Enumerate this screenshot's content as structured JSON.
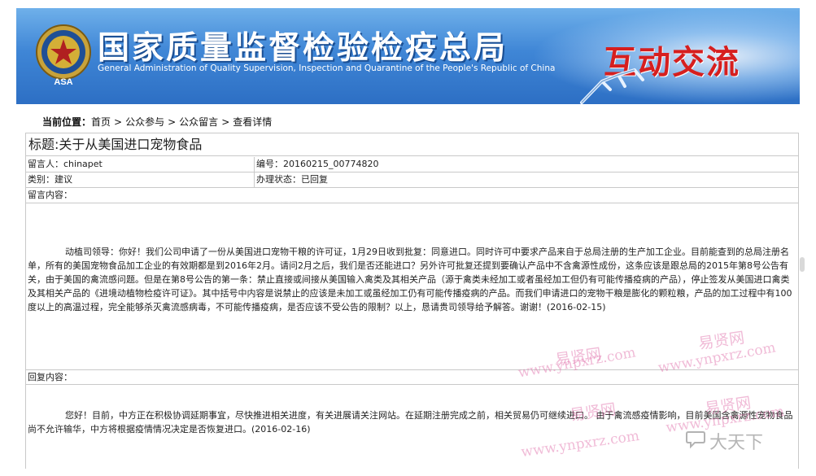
{
  "header": {
    "title": "国家质量监督检验检疫总局",
    "subtitle": "General Administration of Quality Supervision, Inspection and Quarantine of the People's Republic of China",
    "section_tag": "互动交流",
    "emblem_text": "ASA"
  },
  "breadcrumb": {
    "label": "当前位置：",
    "items": [
      "首页",
      "公众参与",
      "公众留言",
      "查看详情"
    ],
    "separator": ">"
  },
  "message": {
    "title": "标题:关于从美国进口宠物食品",
    "author_label": "留言人：",
    "author": "chinapet",
    "id_label": "编号：",
    "id": "20160215_00774820",
    "category_label": "类别：",
    "category": "建议",
    "status_label": "办理状态：",
    "status": "已回复",
    "content_label": "留言内容：",
    "content": "动植司领导：你好！我们公司申请了一份从美国进口宠物干粮的许可证，1月29日收到批复：同意进口。同时许可中要求产品来自于总局注册的生产加工企业。目前能查到的总局注册名单，所有的美国宠物食品加工企业的有效期都是到2016年2月。请问2月之后，我们是否还能进口？另外许可批复还提到要确认产品中不含禽源性成份，这条应该是跟总局的2015年第8号公告有关，由于美国的禽流感问题。但是在第8号公告的第一条：禁止直接或间接从美国输入禽类及其相关产品（源于禽类未经加工或者虽经加工但仍有可能传播疫病的产品），停止签发从美国进口禽类及其相关产品的《进境动植物检疫许可证》。其中括号中内容是说禁止的应该是未加工或虽经加工仍有可能传播疫病的产品。而我们申请进口的宠物干粮是膨化的颗粒粮，产品的加工过程中有100度以上的高温过程，完全能够杀灭禽流感病毒，不可能传播疫病，是否应该不受公告的限制？以上，恳请贵司领导给予解答。谢谢！(2016-02-15)",
    "reply_label": "回复内容：",
    "reply": "您好！目前，中方正在积极协调延期事宜，尽快推进相关进度，有关进展请关注网站。在延期注册完成之前，相关贸易仍可继续进口。 由于禽流感疫情影响，目前美国含禽源性宠物食品尚不允许输华，中方将根据疫情情况决定是否恢复进口。(2016-02-16)"
  },
  "watermarks": {
    "site_cn": "易贤网",
    "site_url": "www.ynpxrz.com",
    "brand": "大天下"
  }
}
